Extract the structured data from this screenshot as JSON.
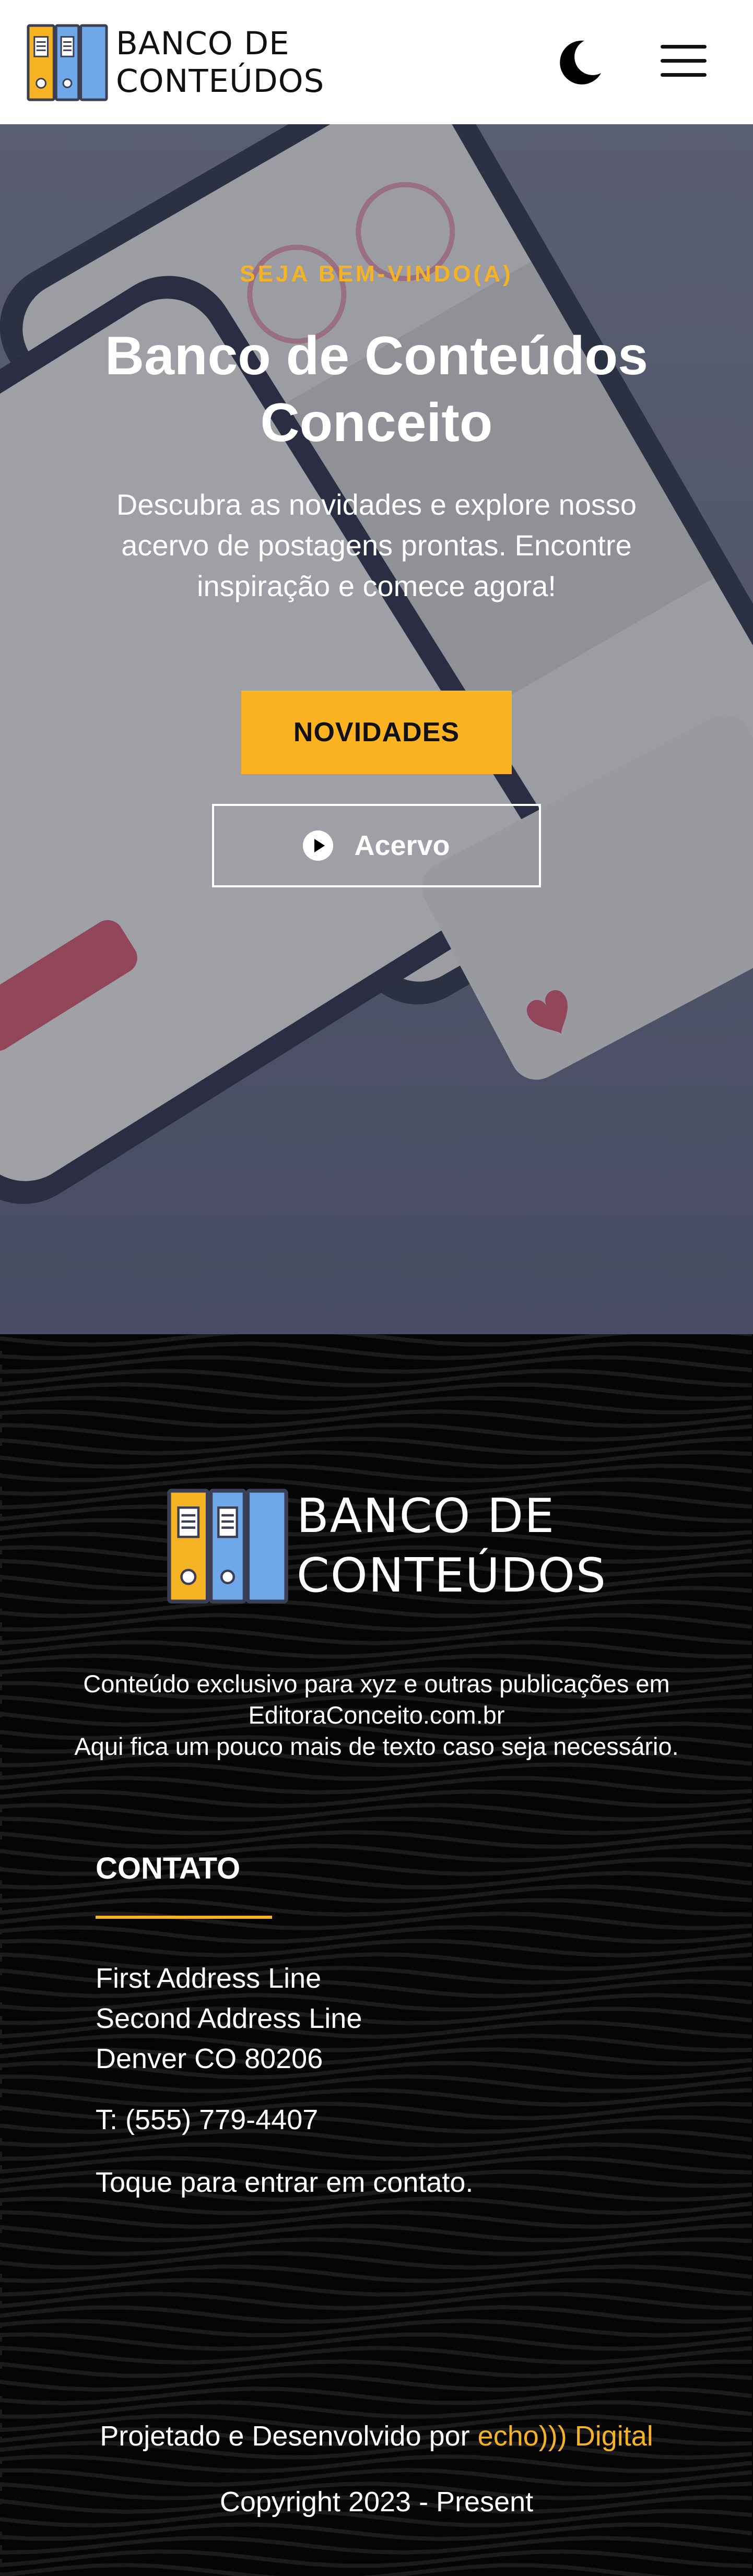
{
  "header": {
    "logo_line1": "BANCO DE",
    "logo_line2": "CONTEÚDOS",
    "theme_toggle_icon": "moon-icon",
    "menu_icon": "hamburger-menu-icon"
  },
  "hero": {
    "welcome": "SEJA BEM-VINDO(A)",
    "title_line1": "Banco de Conteúdos",
    "title_line2": "Conceito",
    "description": "Descubra as novidades e explore nosso acervo de postagens prontas. Encontre inspiração e comece agora!",
    "btn_news": "NOVIDADES",
    "btn_acervo": "Acervo"
  },
  "footer": {
    "logo_line1": "BANCO DE",
    "logo_line2": "CONTEÚDOS",
    "desc_line1": "Conteúdo exclusivo para xyz e outras publicações em",
    "desc_line2": "EditoraConceito.com.br",
    "desc_line3": "Aqui fica um pouco mais de texto caso seja necessário.",
    "contact_title": "CONTATO",
    "address1": "First Address Line",
    "address2": "Second Address Line",
    "address3": "Denver CO 80206",
    "phone": "T: (555) 779-4407",
    "contact_cta": "Toque para entrar em contato.",
    "credits_prefix": "Projetado e Desenvolvido por ",
    "credits_link": "echo))) Digital",
    "copyright": "Copyright 2023 - Present"
  },
  "colors": {
    "accent": "#fbb321",
    "header_bg": "#ffffff",
    "footer_bg": "#050505",
    "hero_bg": "#545870"
  }
}
